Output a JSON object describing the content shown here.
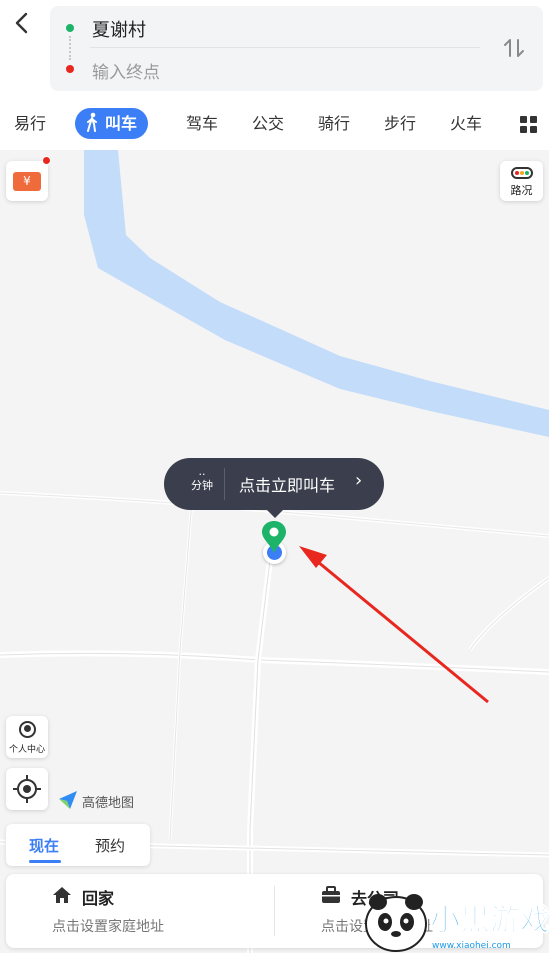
{
  "header": {
    "back_icon": "chevron-left-icon",
    "start_point": "夏谢村",
    "end_placeholder": "输入终点",
    "swap_icon": "swap-vertical-icon",
    "colors": {
      "start_dot": "#1db46a",
      "end_dot": "#e8271f",
      "accent": "#3b7ef6"
    }
  },
  "mode_tabs": {
    "items": [
      {
        "label": "易行",
        "active": false
      },
      {
        "label": "叫车",
        "active": true,
        "icon": "walking-person-icon"
      },
      {
        "label": "驾车",
        "active": false
      },
      {
        "label": "公交",
        "active": false
      },
      {
        "label": "骑行",
        "active": false
      },
      {
        "label": "步行",
        "active": false
      },
      {
        "label": "火车",
        "active": false
      }
    ],
    "more_icon": "grid-icon"
  },
  "map": {
    "coupon_icon": "coupon-ticket-icon",
    "coupon_symbol": "¥",
    "traffic_label": "路况",
    "callout": {
      "minutes_value": "..",
      "minutes_label": "分钟",
      "action_label": "点击立即叫车",
      "chevron": "›"
    },
    "personal_center_label": "个人中心",
    "brand_name": "高德地图"
  },
  "time_tabs": {
    "now_label": "现在",
    "reserve_label": "预约",
    "active": "现在"
  },
  "quick_places": [
    {
      "icon": "home-icon",
      "title": "回家",
      "subtitle": "点击设置家庭地址"
    },
    {
      "icon": "briefcase-icon",
      "title": "去公司",
      "subtitle": "点击设置公司地址"
    }
  ],
  "watermark": {
    "text": "小黑游戏",
    "url": "www.xiaohei.com"
  }
}
